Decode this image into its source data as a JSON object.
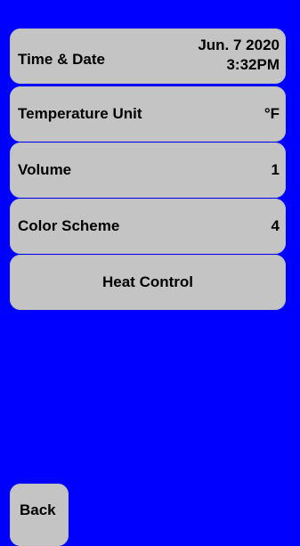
{
  "settings": {
    "time_date": {
      "label": "Time & Date",
      "date": "Jun. 7 2020",
      "time": "3:32PM"
    },
    "temperature_unit": {
      "label": "Temperature Unit",
      "value": "°F"
    },
    "volume": {
      "label": "Volume",
      "value": "1"
    },
    "color_scheme": {
      "label": "Color Scheme",
      "value": "4"
    },
    "heat_control": {
      "label": "Heat Control"
    }
  },
  "footer": {
    "back_label": "Back"
  },
  "colors": {
    "background": "#0000ff",
    "button": "#c4c4c4",
    "text": "#000000"
  }
}
